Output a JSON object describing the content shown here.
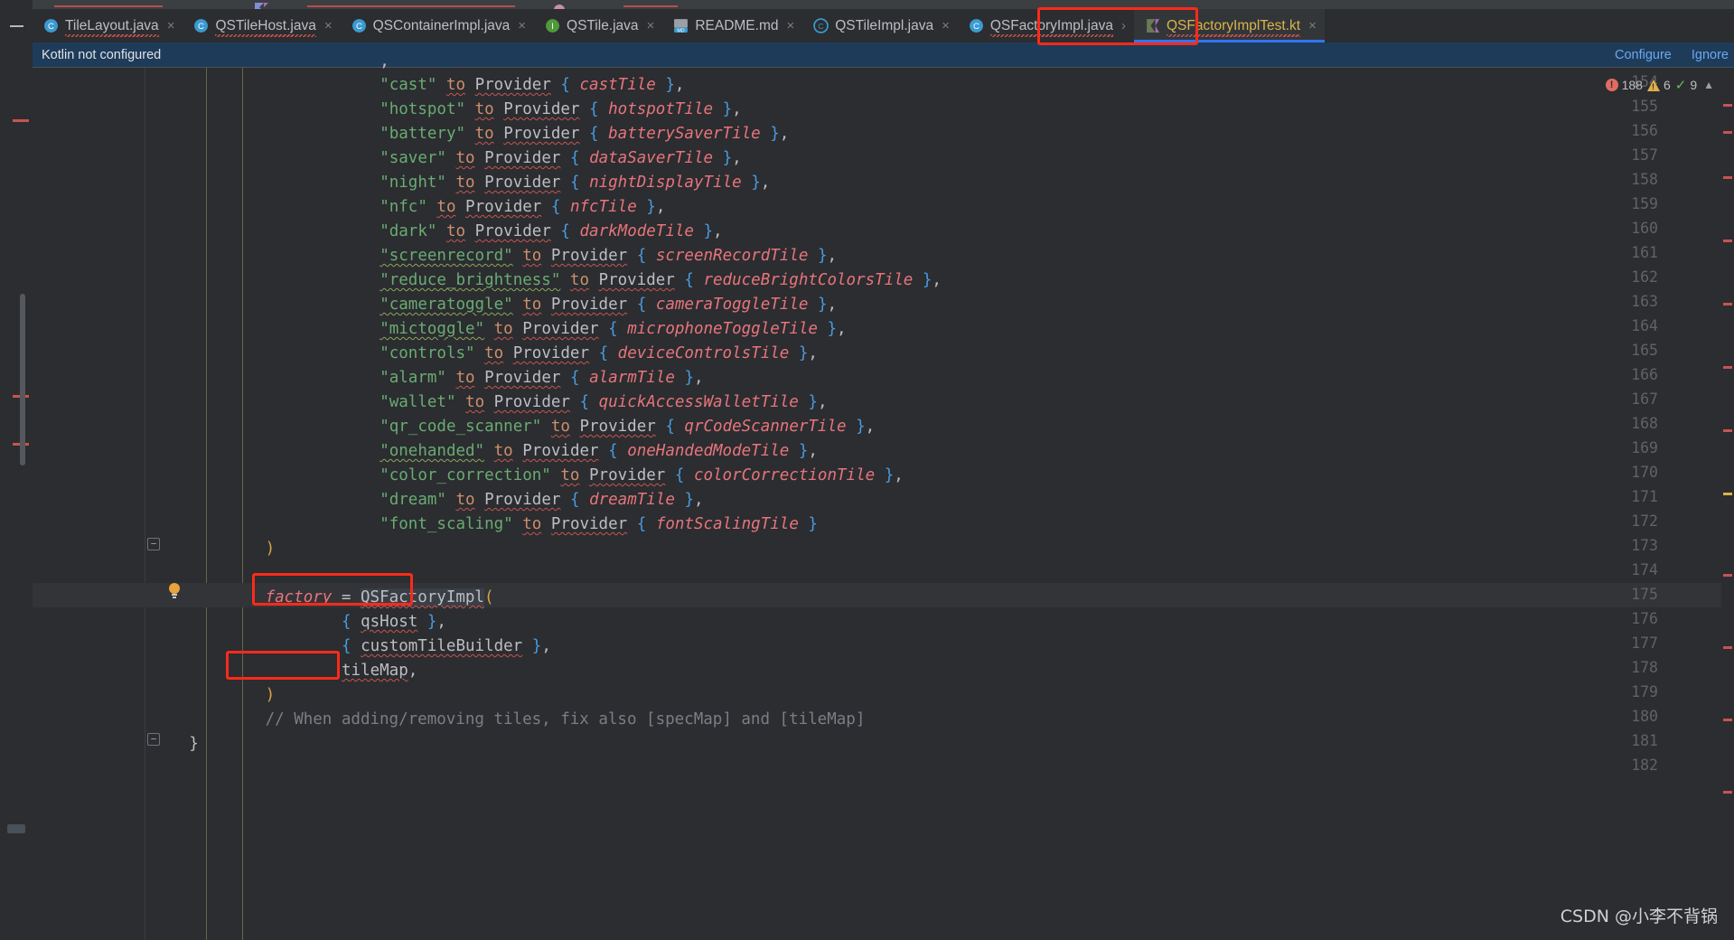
{
  "window": {
    "collapse_icon": "minus-icon"
  },
  "tabs": [
    {
      "label": "TileLayout.java",
      "icon": "java-class-icon",
      "active": false,
      "error": true,
      "close": "×"
    },
    {
      "label": "QSTileHost.java",
      "icon": "java-class-icon",
      "active": false,
      "error": true,
      "close": "×"
    },
    {
      "label": "QSContainerImpl.java",
      "icon": "java-class-icon",
      "active": false,
      "error": false,
      "close": "×"
    },
    {
      "label": "QSTile.java",
      "icon": "java-interface-icon",
      "active": false,
      "error": false,
      "close": "×"
    },
    {
      "label": "README.md",
      "icon": "markdown-icon",
      "active": false,
      "error": false,
      "close": "×"
    },
    {
      "label": "QSTileImpl.java",
      "icon": "java-abstract-icon",
      "active": false,
      "error": false,
      "close": "×"
    },
    {
      "label": "QSFactoryImpl.java",
      "icon": "java-class-icon",
      "active": false,
      "error": true,
      "close": "›"
    },
    {
      "label": "QSFactoryImplTest.kt",
      "icon": "kotlin-class-icon",
      "active": true,
      "error": true,
      "close": "×"
    }
  ],
  "notification": {
    "message": "Kotlin not configured",
    "configure_label": "Configure",
    "ignore_label": "Ignore"
  },
  "inspection": {
    "error_count": "188",
    "warning_count": "6",
    "other_count": "9",
    "error_icon": "error-circle-icon",
    "warning_icon": "warning-triangle-icon",
    "ok_icon": "check-icon",
    "chevron_icon": "chevron-up-icon"
  },
  "editor": {
    "first_line": 154,
    "lines": [
      {
        "n": 154,
        "indent": 24,
        "html": "<span class='t-str'>\"cast\"</span> <span class='t-kw squig'>to</span> <span class='t-ident squig'>Provider</span> <span class='t-brace'>{</span> <span class='t-prop'>castTile</span> <span class='t-brace'>}</span><span class='t-plain'>,</span>"
      },
      {
        "n": 155,
        "indent": 24,
        "html": "<span class='t-str'>\"hotspot\"</span> <span class='t-kw squig'>to</span> <span class='t-ident squig'>Provider</span> <span class='t-brace'>{</span> <span class='t-prop'>hotspotTile</span> <span class='t-brace'>}</span><span class='t-plain'>,</span>"
      },
      {
        "n": 156,
        "indent": 24,
        "html": "<span class='t-str'>\"battery\"</span> <span class='t-kw squig'>to</span> <span class='t-ident squig'>Provider</span> <span class='t-brace'>{</span> <span class='t-prop'>batterySaverTile</span> <span class='t-brace'>}</span><span class='t-plain'>,</span>"
      },
      {
        "n": 157,
        "indent": 24,
        "html": "<span class='t-str'>\"saver\"</span> <span class='t-kw squig'>to</span> <span class='t-ident squig'>Provider</span> <span class='t-brace'>{</span> <span class='t-prop'>dataSaverTile</span> <span class='t-brace'>}</span><span class='t-plain'>,</span>"
      },
      {
        "n": 158,
        "indent": 24,
        "html": "<span class='t-str'>\"night\"</span> <span class='t-kw squig'>to</span> <span class='t-ident squig'>Provider</span> <span class='t-brace'>{</span> <span class='t-prop'>nightDisplayTile</span> <span class='t-brace'>}</span><span class='t-plain'>,</span>"
      },
      {
        "n": 159,
        "indent": 24,
        "html": "<span class='t-str'>\"nfc\"</span> <span class='t-kw squig'>to</span> <span class='t-ident squig'>Provider</span> <span class='t-brace'>{</span> <span class='t-prop'>nfcTile</span> <span class='t-brace'>}</span><span class='t-plain'>,</span>"
      },
      {
        "n": 160,
        "indent": 24,
        "html": "<span class='t-str'>\"dark\"</span> <span class='t-kw squig'>to</span> <span class='t-ident squig'>Provider</span> <span class='t-brace'>{</span> <span class='t-prop'>darkModeTile</span> <span class='t-brace'>}</span><span class='t-plain'>,</span>"
      },
      {
        "n": 161,
        "indent": 24,
        "html": "<span class='t-str squig-g'>\"screenrecord\"</span> <span class='t-kw squig'>to</span> <span class='t-ident squig'>Provider</span> <span class='t-brace'>{</span> <span class='t-prop'>screenRecordTile</span> <span class='t-brace'>}</span><span class='t-plain'>,</span>"
      },
      {
        "n": 162,
        "indent": 24,
        "html": "<span class='t-str squig-g'>\"reduce_brightness\"</span> <span class='t-kw squig'>to</span> <span class='t-ident squig'>Provider</span> <span class='t-brace'>{</span> <span class='t-prop'>reduceBrightColorsTile</span> <span class='t-brace'>}</span><span class='t-plain'>,</span>"
      },
      {
        "n": 163,
        "indent": 24,
        "html": "<span class='t-str squig-g'>\"cameratoggle\"</span> <span class='t-kw squig'>to</span> <span class='t-ident squig'>Provider</span> <span class='t-brace'>{</span> <span class='t-prop'>cameraToggleTile</span> <span class='t-brace'>}</span><span class='t-plain'>,</span>"
      },
      {
        "n": 164,
        "indent": 24,
        "html": "<span class='t-str squig-g'>\"mictoggle\"</span> <span class='t-kw squig'>to</span> <span class='t-ident squig'>Provider</span> <span class='t-brace'>{</span> <span class='t-prop'>microphoneToggleTile</span> <span class='t-brace'>}</span><span class='t-plain'>,</span>"
      },
      {
        "n": 165,
        "indent": 24,
        "html": "<span class='t-str'>\"controls\"</span> <span class='t-kw squig'>to</span> <span class='t-ident squig'>Provider</span> <span class='t-brace'>{</span> <span class='t-prop'>deviceControlsTile</span> <span class='t-brace'>}</span><span class='t-plain'>,</span>"
      },
      {
        "n": 166,
        "indent": 24,
        "html": "<span class='t-str'>\"alarm\"</span> <span class='t-kw squig'>to</span> <span class='t-ident squig'>Provider</span> <span class='t-brace'>{</span> <span class='t-prop'>alarmTile</span> <span class='t-brace'>}</span><span class='t-plain'>,</span>"
      },
      {
        "n": 167,
        "indent": 24,
        "html": "<span class='t-str'>\"wallet\"</span> <span class='t-kw squig'>to</span> <span class='t-ident squig'>Provider</span> <span class='t-brace'>{</span> <span class='t-prop'>quickAccessWalletTile</span> <span class='t-brace'>}</span><span class='t-plain'>,</span>"
      },
      {
        "n": 168,
        "indent": 24,
        "html": "<span class='t-str'>\"qr_code_scanner\"</span> <span class='t-kw squig'>to</span> <span class='t-ident squig'>Provider</span> <span class='t-brace'>{</span> <span class='t-prop'>qrCodeScannerTile</span> <span class='t-brace'>}</span><span class='t-plain'>,</span>"
      },
      {
        "n": 169,
        "indent": 24,
        "html": "<span class='t-str squig-g'>\"onehanded\"</span> <span class='t-kw squig'>to</span> <span class='t-ident squig'>Provider</span> <span class='t-brace'>{</span> <span class='t-prop'>oneHandedModeTile</span> <span class='t-brace'>}</span><span class='t-plain'>,</span>"
      },
      {
        "n": 170,
        "indent": 24,
        "html": "<span class='t-str'>\"color_correction\"</span> <span class='t-kw squig'>to</span> <span class='t-ident squig'>Provider</span> <span class='t-brace'>{</span> <span class='t-prop'>colorCorrectionTile</span> <span class='t-brace'>}</span><span class='t-plain'>,</span>"
      },
      {
        "n": 171,
        "indent": 24,
        "html": "<span class='t-str'>\"dream\"</span> <span class='t-kw squig'>to</span> <span class='t-ident squig'>Provider</span> <span class='t-brace'>{</span> <span class='t-prop'>dreamTile</span> <span class='t-brace'>}</span><span class='t-plain'>,</span>"
      },
      {
        "n": 172,
        "indent": 24,
        "html": "<span class='t-str'>\"font_scaling\"</span> <span class='t-kw squig'>to</span> <span class='t-ident squig'>Provider</span> <span class='t-brace'>{</span> <span class='t-prop'>fontScalingTile</span> <span class='t-brace'>}</span>"
      },
      {
        "n": 173,
        "indent": 12,
        "html": "<span class='t-paren'>)</span>"
      },
      {
        "n": 174,
        "indent": 0,
        "html": ""
      },
      {
        "n": 175,
        "indent": 12,
        "html": "<span class='t-prop'>factory</span> <span class='t-plain'>=</span> <span class='t-sel t-ident squig'>QSFactoryImpl</span><span class='t-paren'>(</span>"
      },
      {
        "n": 176,
        "indent": 20,
        "html": "<span class='t-brace'>{</span> <span class='t-ident squig'>qsHost</span> <span class='t-brace'>}</span><span class='t-plain'>,</span>"
      },
      {
        "n": 177,
        "indent": 20,
        "html": "<span class='t-brace'>{</span> <span class='t-ident squig'>customTileBuilder</span> <span class='t-brace'>}</span><span class='t-plain'>,</span>"
      },
      {
        "n": 178,
        "indent": 20,
        "html": "<span class='t-ident squig'>tileMap</span><span class='t-plain'>,</span>"
      },
      {
        "n": 179,
        "indent": 12,
        "html": "<span class='t-paren'>)</span>"
      },
      {
        "n": 180,
        "indent": 12,
        "html": "<span class='t-comment'>// When adding/removing tiles, fix also [specMap] and [tileMap]</span>"
      },
      {
        "n": 181,
        "indent": 4,
        "html": "<span class='t-plain'>}</span>"
      },
      {
        "n": 182,
        "indent": 0,
        "html": ""
      }
    ],
    "partial_top_line": "<span class='t-plain'>,</span>"
  },
  "annotations": [
    {
      "name": "tab-highlight-box",
      "color": "#fc2a1a",
      "target": "QSFactoryImplTest.kt tab"
    },
    {
      "name": "factory-highlight-box",
      "color": "#fc2a1a",
      "target": "QSFactoryImpl("
    },
    {
      "name": "tilemap-highlight-box",
      "color": "#fc2a1a",
      "target": "tileMap,"
    }
  ],
  "watermark": {
    "text": "CSDN @小李不背锅"
  },
  "colors": {
    "accent_blue": "#3574f0",
    "notification_bg": "#1e3c5a",
    "editor_bg": "#2b2d30",
    "annotation_red": "#fc2a1a",
    "string_green": "#6aab73",
    "keyword_orange": "#cf8e6d",
    "property_pink": "#e8747c",
    "brace_blue": "#4a9ae0",
    "paren_gold": "#d9a343",
    "comment_grey": "#7a7e85"
  }
}
